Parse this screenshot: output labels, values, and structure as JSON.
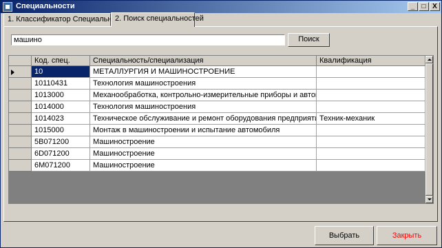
{
  "window": {
    "title": "Специальности",
    "minimize": "_",
    "maximize": "□",
    "close": "X"
  },
  "tabs": [
    {
      "label": "1. Классификатор Специальностей"
    },
    {
      "label": "2. Поиск специальностей"
    }
  ],
  "search": {
    "value": "машино",
    "button_label": "Поиск"
  },
  "grid": {
    "columns": [
      "Код. спец.",
      "Специальность/специализация",
      "Квалификация"
    ],
    "rows": [
      {
        "code": "10",
        "name": "МЕТАЛЛУРГИЯ И МАШИНОСТРОЕНИЕ",
        "qual": ""
      },
      {
        "code": "10110431",
        "name": "Технология машиностроения",
        "qual": ""
      },
      {
        "code": "1013000",
        "name": "Механообработка, контрольно-измерительные приборы и автоматика в м...",
        "qual": ""
      },
      {
        "code": "1014000",
        "name": "Технология машиностроения",
        "qual": ""
      },
      {
        "code": "1014023",
        "name": "Техническое обслуживание и ремонт оборудования предприятий машинос...",
        "qual": "Техник-механик"
      },
      {
        "code": "1015000",
        "name": "Монтаж   в машиностроении и испытание автомобиля",
        "qual": ""
      },
      {
        "code": "5В071200",
        "name": "Машиностроение",
        "qual": ""
      },
      {
        "code": "6D071200",
        "name": "Машиностроение",
        "qual": ""
      },
      {
        "code": "6М071200",
        "name": "Машиностроение",
        "qual": ""
      }
    ]
  },
  "buttons": {
    "select_label": "Выбрать",
    "close_label": "Закрыть"
  },
  "colors": {
    "selection": "#0a246a",
    "close_text": "#ff0000",
    "face": "#d4d0c8"
  }
}
